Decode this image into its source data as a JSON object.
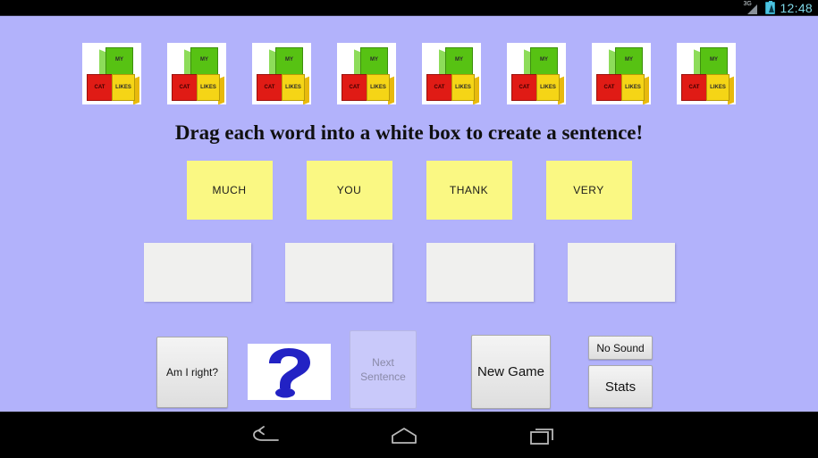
{
  "status_bar": {
    "network_label": "3G",
    "network_icon": "signal-triangle-icon",
    "battery_icon": "battery-charging-icon",
    "clock": "12:48"
  },
  "game": {
    "instruction": "Drag each word into a white box to create a sentence!",
    "background_color": "#b2b2fb",
    "thumbnails": [
      {
        "alt": "blocks-image",
        "words": {
          "top": "MY",
          "left": "CAT",
          "right": "LIKES"
        }
      },
      {
        "alt": "blocks-image",
        "words": {
          "top": "MY",
          "left": "CAT",
          "right": "LIKES"
        }
      },
      {
        "alt": "blocks-image",
        "words": {
          "top": "MY",
          "left": "CAT",
          "right": "LIKES"
        }
      },
      {
        "alt": "blocks-image",
        "words": {
          "top": "MY",
          "left": "CAT",
          "right": "LIKES"
        }
      },
      {
        "alt": "blocks-image",
        "words": {
          "top": "MY",
          "left": "CAT",
          "right": "LIKES"
        }
      },
      {
        "alt": "blocks-image",
        "words": {
          "top": "MY",
          "left": "CAT",
          "right": "LIKES"
        }
      },
      {
        "alt": "blocks-image",
        "words": {
          "top": "MY",
          "left": "CAT",
          "right": "LIKES"
        }
      },
      {
        "alt": "blocks-image",
        "words": {
          "top": "MY",
          "left": "CAT",
          "right": "LIKES"
        }
      }
    ],
    "word_tiles": [
      {
        "label": "MUCH",
        "color": "#faf883"
      },
      {
        "label": "YOU",
        "color": "#faf883"
      },
      {
        "label": "THANK",
        "color": "#faf883"
      },
      {
        "label": "VERY",
        "color": "#faf883"
      }
    ],
    "drop_boxes": [
      {
        "value": ""
      },
      {
        "value": ""
      },
      {
        "value": ""
      },
      {
        "value": ""
      }
    ],
    "controls": {
      "am_i_right": "Am I right?",
      "hint_icon": "question-mark-icon",
      "hint_color": "#2222c4",
      "next_sentence": "Next\nSentence",
      "next_sentence_line1": "Next",
      "next_sentence_line2": "Sentence",
      "next_sentence_disabled": true,
      "new_game": "New Game",
      "no_sound": "No Sound",
      "stats": "Stats"
    }
  },
  "nav_bar": {
    "back_icon": "back-arrow-icon",
    "home_icon": "home-icon",
    "recents_icon": "recents-icon"
  }
}
